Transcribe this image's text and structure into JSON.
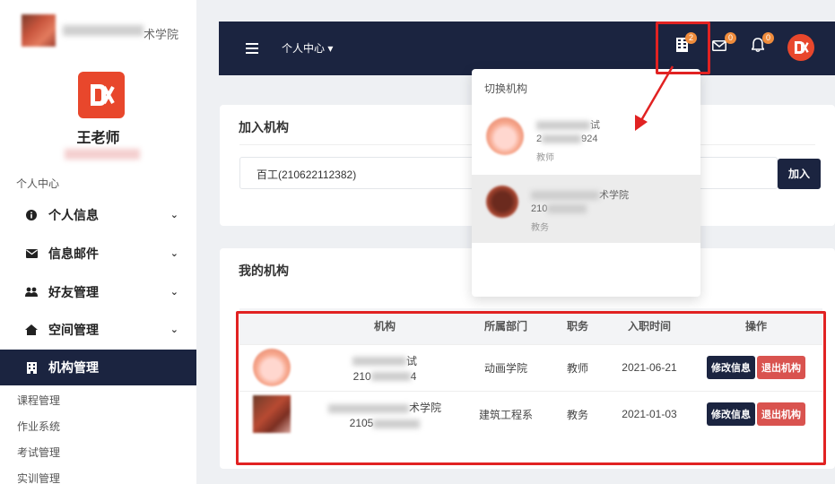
{
  "sidebar": {
    "school_name_visible": "术学院",
    "teacher_name": "王老师",
    "section_title": "个人中心",
    "items": [
      {
        "label": "个人信息",
        "icon": "info-circle-icon"
      },
      {
        "label": "信息邮件",
        "icon": "envelope-icon"
      },
      {
        "label": "好友管理",
        "icon": "users-icon"
      },
      {
        "label": "空间管理",
        "icon": "home-icon"
      },
      {
        "label": "机构管理",
        "icon": "building-icon"
      }
    ],
    "sub_items": [
      "课程管理",
      "作业系统",
      "考试管理",
      "实训管理"
    ]
  },
  "topbar": {
    "menu_label": "个人中心",
    "badges": {
      "org": "2",
      "mail": "0",
      "notify": "0"
    }
  },
  "join_card": {
    "title": "加入机构",
    "input_value": "百工(210622112382)",
    "button_label": "加入"
  },
  "my_orgs": {
    "title": "我的机构",
    "columns": [
      "机构",
      "所属部门",
      "职务",
      "入职时间",
      "操作"
    ],
    "rows": [
      {
        "name_tail": "试",
        "code_head": "210",
        "code_tail": "4",
        "dept": "动画学院",
        "role": "教师",
        "date": "2021-06-21"
      },
      {
        "name_tail": "术学院",
        "code_head": "2105",
        "code_tail": "",
        "dept": "建筑工程系",
        "role": "教务",
        "date": "2021-01-03"
      }
    ],
    "edit_label": "修改信息",
    "quit_label": "退出机构"
  },
  "dropdown": {
    "title": "切换机构",
    "items": [
      {
        "name_tail": "试",
        "code_head": "2",
        "code_tail": "924",
        "role": "教师"
      },
      {
        "name_tail": "术学院",
        "code_head": "210",
        "code_tail": "",
        "role": "教务"
      }
    ]
  },
  "colors": {
    "navy": "#1b2440",
    "brand": "#e8472c",
    "badge": "#f08c3c",
    "danger": "#d9534f",
    "annotation": "#e12222"
  }
}
